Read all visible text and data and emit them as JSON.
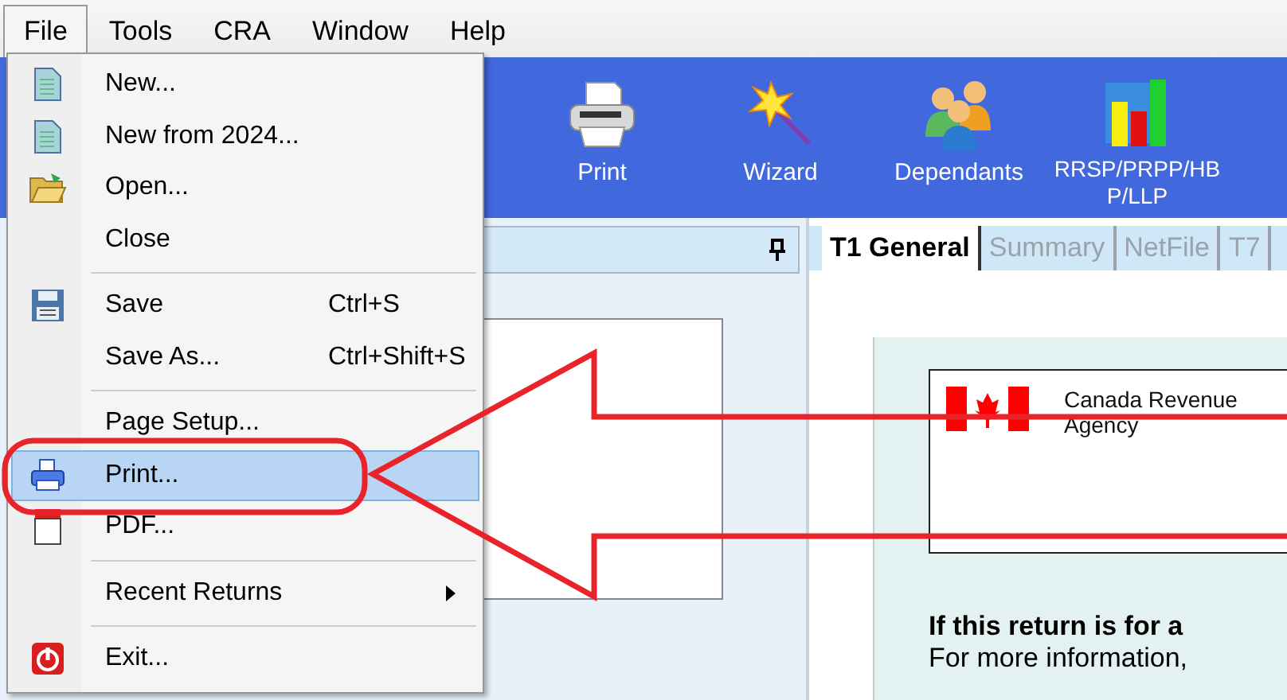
{
  "menu_bar": [
    {
      "label": "File",
      "selected": true
    },
    {
      "label": "Tools",
      "selected": false
    },
    {
      "label": "CRA",
      "selected": false
    },
    {
      "label": "Window",
      "selected": false
    },
    {
      "label": "Help",
      "selected": false
    }
  ],
  "toolbar": [
    {
      "label": "Print"
    },
    {
      "label": "Wizard"
    },
    {
      "label": "Dependants"
    },
    {
      "label": "RRSP/PRPP/HBP/LLP"
    }
  ],
  "file_menu": [
    {
      "kind": "item",
      "label": "New...",
      "submenu": false,
      "selected": false
    },
    {
      "kind": "item",
      "label": "New from 2024...",
      "submenu": false,
      "selected": false
    },
    {
      "kind": "item",
      "label": "Open...",
      "submenu": false,
      "selected": false
    },
    {
      "kind": "item",
      "label": "Close",
      "submenu": false,
      "selected": false
    },
    {
      "kind": "separator"
    },
    {
      "kind": "item",
      "label": "Save",
      "shortcut": "Ctrl+S",
      "submenu": false,
      "selected": false
    },
    {
      "kind": "item",
      "label": "Save As...",
      "shortcut": "Ctrl+Shift+S",
      "submenu": false,
      "selected": false
    },
    {
      "kind": "separator"
    },
    {
      "kind": "item",
      "label": "Page Setup...",
      "submenu": false,
      "selected": false
    },
    {
      "kind": "item",
      "label": "Print...",
      "submenu": false,
      "selected": true
    },
    {
      "kind": "item",
      "label": "PDF...",
      "submenu": false,
      "selected": false
    },
    {
      "kind": "separator"
    },
    {
      "kind": "item",
      "label": "Recent Returns",
      "submenu": true,
      "selected": false
    },
    {
      "kind": "separator"
    },
    {
      "kind": "item",
      "label": "Exit...",
      "submenu": false,
      "selected": false
    }
  ],
  "tabs": [
    {
      "label": "T1 General",
      "selected": true
    },
    {
      "label": "Summary",
      "selected": false
    },
    {
      "label": "NetFile",
      "selected": false
    },
    {
      "label": "T7",
      "selected": false
    }
  ],
  "document": {
    "agency": "Canada Revenue Agency",
    "heading": "If this return is for a",
    "info": "For more information,"
  }
}
